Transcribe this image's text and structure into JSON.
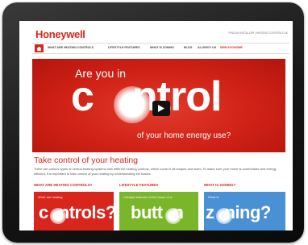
{
  "header": {
    "logo": "Honeywell",
    "top_links": "FIND AN INSTALLER | HEATING CONTROLS UK"
  },
  "nav": {
    "items": [
      {
        "label": "WHAT ARE HEATING CONTROLS"
      },
      {
        "label": "LIFESTYLE FEATURES"
      },
      {
        "label": "WHAT IS ZONING"
      },
      {
        "label": "BLOG"
      },
      {
        "label": "ALLERGY UK"
      },
      {
        "label": "NEW EVOHOME"
      }
    ]
  },
  "hero": {
    "line1": "Are you in",
    "headline_a": "c",
    "headline_b": "ntrol",
    "line2": "of your home energy use?"
  },
  "main": {
    "heading": "Take control of your heating",
    "intro": "There are various types of central heating systems with different heating controls, which come in all shapes and sizes. To make sure your home is comfortable and energy efficient, it is important to take control of your heating by understanding the basics."
  },
  "features": [
    {
      "title": "WHAT ARE HEATING CONTROLS?",
      "tile_small": "What are heating",
      "tile_big_a": "c",
      "tile_big_b": "ntrols?",
      "color": "#d8261c"
    },
    {
      "title": "LIFESTYLE FEATURES",
      "tile_small": "Lifestyle features at the touch of a",
      "tile_big_a": "butt",
      "tile_big_b": "n",
      "color": "#7ab629"
    },
    {
      "title": "WHAT IS ZONING?",
      "tile_small": "What is",
      "tile_big_a": "z",
      "tile_big_b": "ning?",
      "color": "#4a90d4"
    }
  ]
}
